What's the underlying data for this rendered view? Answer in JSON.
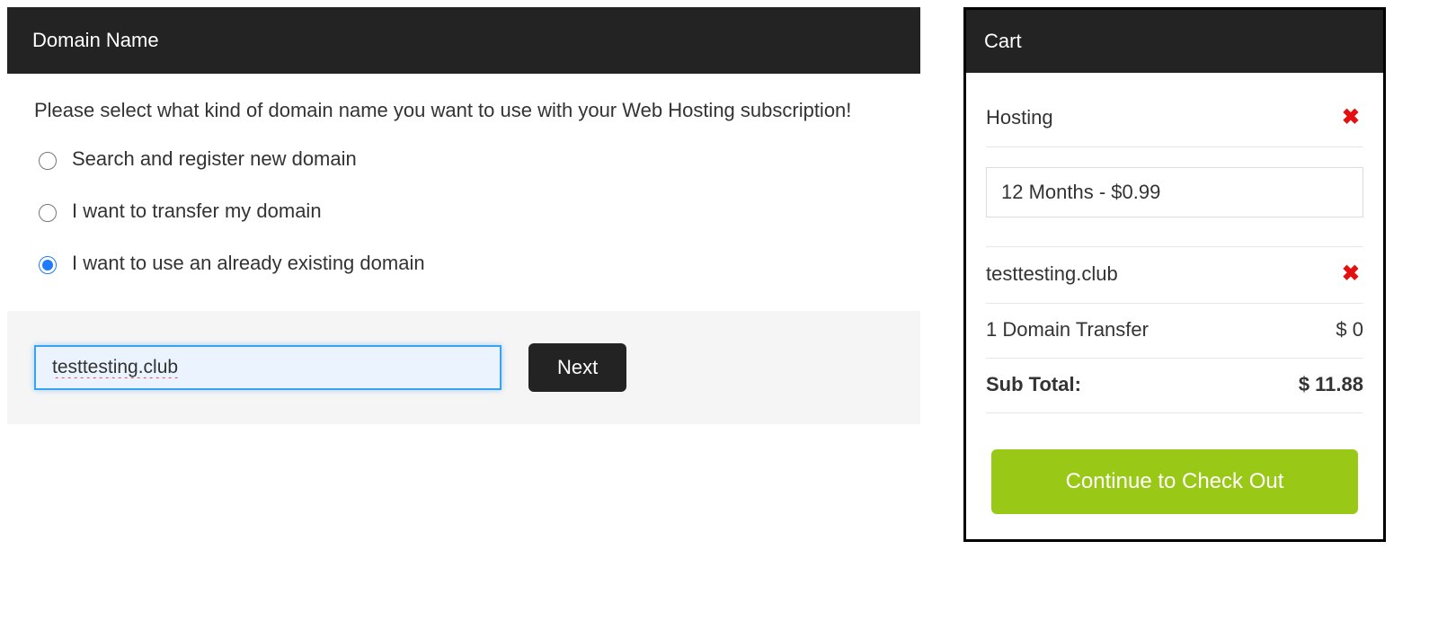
{
  "domain_panel": {
    "title": "Domain Name",
    "prompt": "Please select what kind of domain name you want to use with your Web Hosting subscription!",
    "options": [
      "Search and register new domain",
      "I want to transfer my domain",
      "I want to use an already existing domain"
    ],
    "selected_index": 2,
    "domain_value": "testtesting.club",
    "next_label": "Next"
  },
  "cart": {
    "title": "Cart",
    "hosting_label": "Hosting",
    "period_selected": "12 Months - $0.99",
    "domain_name": "testtesting.club",
    "transfer_label": "1 Domain Transfer",
    "transfer_price": "$ 0",
    "subtotal_label": "Sub Total:",
    "subtotal_value": "$ 11.88",
    "checkout_label": "Continue to Check Out"
  }
}
